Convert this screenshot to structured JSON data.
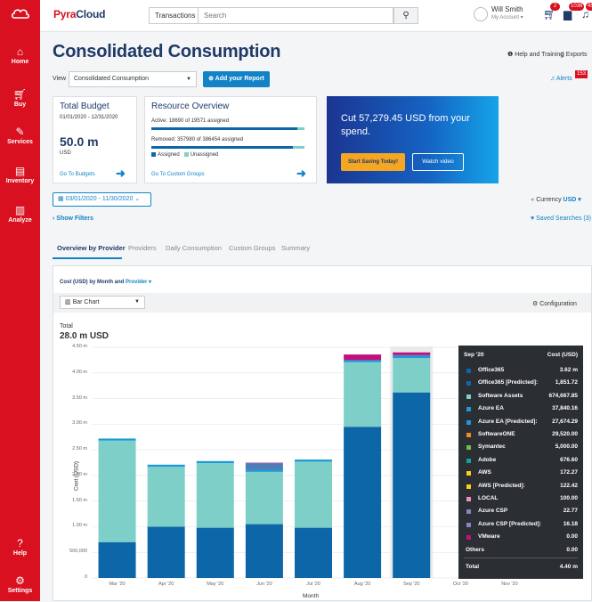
{
  "nav": {
    "items": [
      {
        "icon": "cloud-logo-icon",
        "label": ""
      },
      {
        "icon": "home-icon",
        "label": "Home"
      },
      {
        "icon": "cart-icon",
        "label": "Buy"
      },
      {
        "icon": "wrench-icon",
        "label": "Services"
      },
      {
        "icon": "inventory-icon",
        "label": "Inventory"
      },
      {
        "icon": "chart-icon",
        "label": "Analyze"
      },
      {
        "icon": "help-icon",
        "label": "Help"
      },
      {
        "icon": "gear-icon",
        "label": "Settings"
      }
    ]
  },
  "header": {
    "brand_pyra": "Pyra",
    "brand_cloud": "Cloud",
    "transactions": "Transactions ▾",
    "search_placeholder": "Search",
    "user_name": "Will Smith",
    "user_account": "My Account ▾",
    "cart_badge": "2",
    "briefcase_badge": "1036",
    "bell_badge": "452"
  },
  "page": {
    "title": "Consolidated Consumption",
    "help": "Help and Training",
    "exports": "Exports",
    "view_label": "View",
    "view_value": "Consolidated Consumption",
    "add_report": "Add your Report",
    "alerts": "Alerts",
    "alerts_badge": "153"
  },
  "budget": {
    "title": "Total Budget",
    "range": "01/01/2020 - 12/31/2020",
    "amount": "50.0 m",
    "currency": "USD",
    "link": "Go To Budgets"
  },
  "resource": {
    "title": "Resource Overview",
    "active": "Active: 18690 of 19571 assigned",
    "active_fraction": 0.955,
    "removed": "Removed: 357980 of 386454 assigned",
    "removed_fraction": 0.926,
    "legend_assigned": "Assigned",
    "legend_unassigned": "Unassigned",
    "link": "Go To Custom Groups"
  },
  "promo": {
    "text": "Cut 57,279.45 USD from your spend.",
    "btn1": "Start Saving Today!",
    "btn2": "Watch video"
  },
  "filters": {
    "date": "03/01/2020 - 11/30/2020",
    "currency_label": "Currency",
    "currency_value": "USD ▾",
    "show_filters": "Show Filters",
    "saved": "Saved Searches (3)"
  },
  "tabs": [
    "Overview by Provider",
    "Providers",
    "Daily Consumption",
    "Custom Groups",
    "Summary"
  ],
  "chart_card": {
    "title_prefix": "Cost (USD) by Month and",
    "title_link": "Provider ▾",
    "chart_type": "Bar Chart",
    "configuration": "Configuration",
    "total_label": "Total",
    "total_value": "28.0 m USD"
  },
  "chart_data": {
    "type": "bar",
    "stacked": true,
    "xlabel": "Month",
    "ylabel": "Cost (USD)",
    "ylim": [
      0,
      4500000
    ],
    "yticks": [
      "0",
      "500,000",
      "1.00 m",
      "1.50 m",
      "2.00 m",
      "2.50 m",
      "3.00 m",
      "3.50 m",
      "4.00 m",
      "4.50 m"
    ],
    "categories": [
      "Mar '20",
      "Apr '20",
      "May '20",
      "Jun '20",
      "Jul '20",
      "Aug '20",
      "Sep '20",
      "Oct '20",
      "Nov '20"
    ],
    "colors": {
      "office": "#0d66a8",
      "software_assets": "#7fcfc9",
      "azure": "#1a9ad6",
      "vmware": "#c0117f",
      "other": "#7e57a8"
    },
    "series": [
      {
        "name": "Office365",
        "values": [
          700000,
          1000000,
          980000,
          1050000,
          980000,
          2950000,
          3620000,
          0,
          0
        ]
      },
      {
        "name": "Software Assets",
        "values": [
          1980000,
          1170000,
          1260000,
          1020000,
          1290000,
          1260000,
          670000,
          0,
          0
        ]
      },
      {
        "name": "Azure EA",
        "values": [
          40000,
          40000,
          40000,
          40000,
          40000,
          40000,
          38000,
          0,
          0
        ]
      },
      {
        "name": "VMware",
        "values": [
          0,
          0,
          0,
          0,
          0,
          0,
          0,
          0,
          0
        ]
      },
      {
        "name": "Azure CSP",
        "values": [
          0,
          0,
          0,
          120000,
          0,
          0,
          23000,
          0,
          0
        ]
      },
      {
        "name": "Other",
        "values": [
          0,
          0,
          0,
          20000,
          0,
          110000,
          50000,
          0,
          0
        ]
      }
    ]
  },
  "tooltip": {
    "month": "Sep '20",
    "col": "Cost (USD)",
    "rows": [
      {
        "name": "Office365",
        "value": "3.62 m",
        "color": "#0d66a8"
      },
      {
        "name": "Office365 [Predicted]:",
        "value": "1,851.72",
        "color": "#0d66a8"
      },
      {
        "name": "Software Assets",
        "value": "674,667.85",
        "color": "#7fcfc9"
      },
      {
        "name": "Azure EA",
        "value": "37,840.16",
        "color": "#1a9ad6"
      },
      {
        "name": "Azure EA [Predicted]:",
        "value": "27,674.29",
        "color": "#1a9ad6"
      },
      {
        "name": "SoftwareONE",
        "value": "29,520.00",
        "color": "#f08a24"
      },
      {
        "name": "Symantec",
        "value": "5,000.00",
        "color": "#6cc04a"
      },
      {
        "name": "Adobe",
        "value": "676.60",
        "color": "#14a398"
      },
      {
        "name": "AWS",
        "value": "172.27",
        "color": "#f5d21d"
      },
      {
        "name": "AWS [Predicted]:",
        "value": "122.42",
        "color": "#f5d21d"
      },
      {
        "name": "LOCAL",
        "value": "100.00",
        "color": "#f28cb8"
      },
      {
        "name": "Azure CSP",
        "value": "22.77",
        "color": "#8a82c4"
      },
      {
        "name": "Azure CSP [Predicted]:",
        "value": "16.18",
        "color": "#8a82c4"
      },
      {
        "name": "VMware",
        "value": "0.00",
        "color": "#c0117f"
      },
      {
        "name": "Others",
        "value": "0.00",
        "color": ""
      }
    ],
    "total_label": "Total",
    "total_value": "4.40 m"
  }
}
